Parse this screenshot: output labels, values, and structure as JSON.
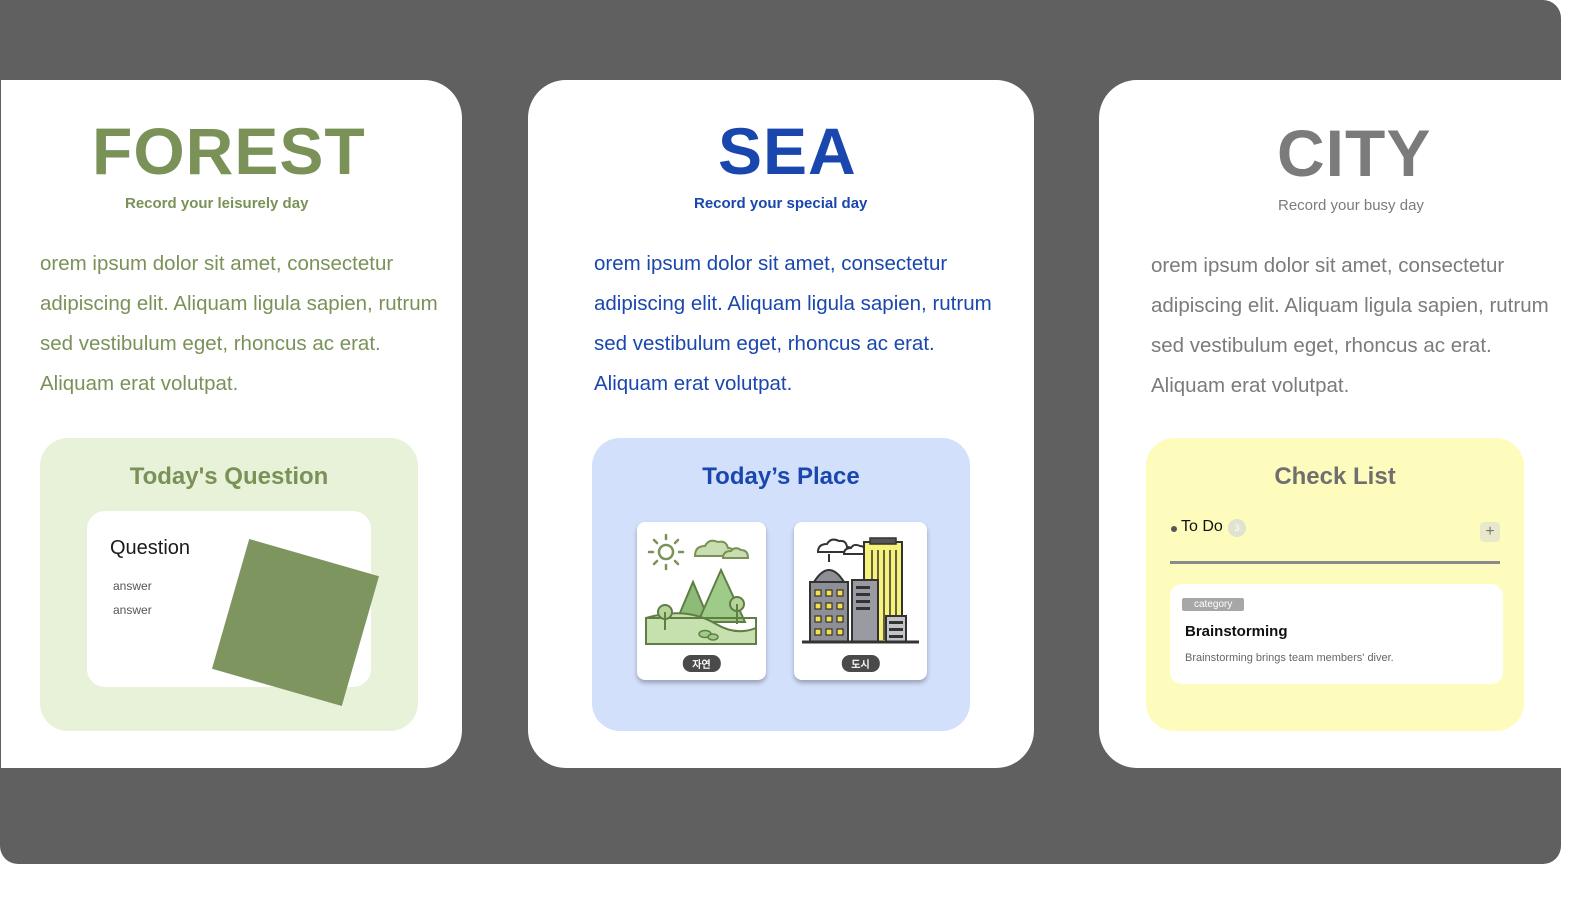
{
  "cards": {
    "forest": {
      "title": "FOREST",
      "subtitle": "Record your leisurely day",
      "body": "orem ipsum dolor sit amet, consectetur adipiscing elit. Aliquam ligula sapien, rutrum sed vestibulum eget, rhoncus ac erat. Aliquam erat volutpat.",
      "panel_title": "Today's Question",
      "question": {
        "title": "Question",
        "answers": [
          "answer",
          "answer"
        ]
      },
      "color": "#7a9258",
      "panel_color": "#e8f2d9"
    },
    "sea": {
      "title": "SEA",
      "subtitle": "Record your special day",
      "body": "orem ipsum dolor sit amet, consectetur adipiscing elit. Aliquam ligula sapien, rutrum sed vestibulum eget, rhoncus ac erat. Aliquam erat volutpat.",
      "panel_title": "Today’s Place",
      "places": [
        {
          "label": "자연",
          "icon": "mountain-landscape-icon"
        },
        {
          "label": "도시",
          "icon": "city-buildings-icon"
        }
      ],
      "color": "#1a47ad",
      "panel_color": "#d3e0fb"
    },
    "city": {
      "title": "CITY",
      "subtitle": "Record your busy day",
      "body": "orem ipsum dolor sit amet, consectetur adipiscing elit. Aliquam ligula sapien, rutrum sed vestibulum eget, rhoncus ac erat. Aliquam erat volutpat.",
      "panel_title": "Check List",
      "todo": {
        "label": "To Do",
        "count": "3",
        "add_icon": "+",
        "task": {
          "tag": "category",
          "title": "Brainstorming",
          "description": "Brainstorming brings team members' diver."
        }
      },
      "color": "#7b7b7b",
      "panel_color": "#fefcbd"
    }
  }
}
